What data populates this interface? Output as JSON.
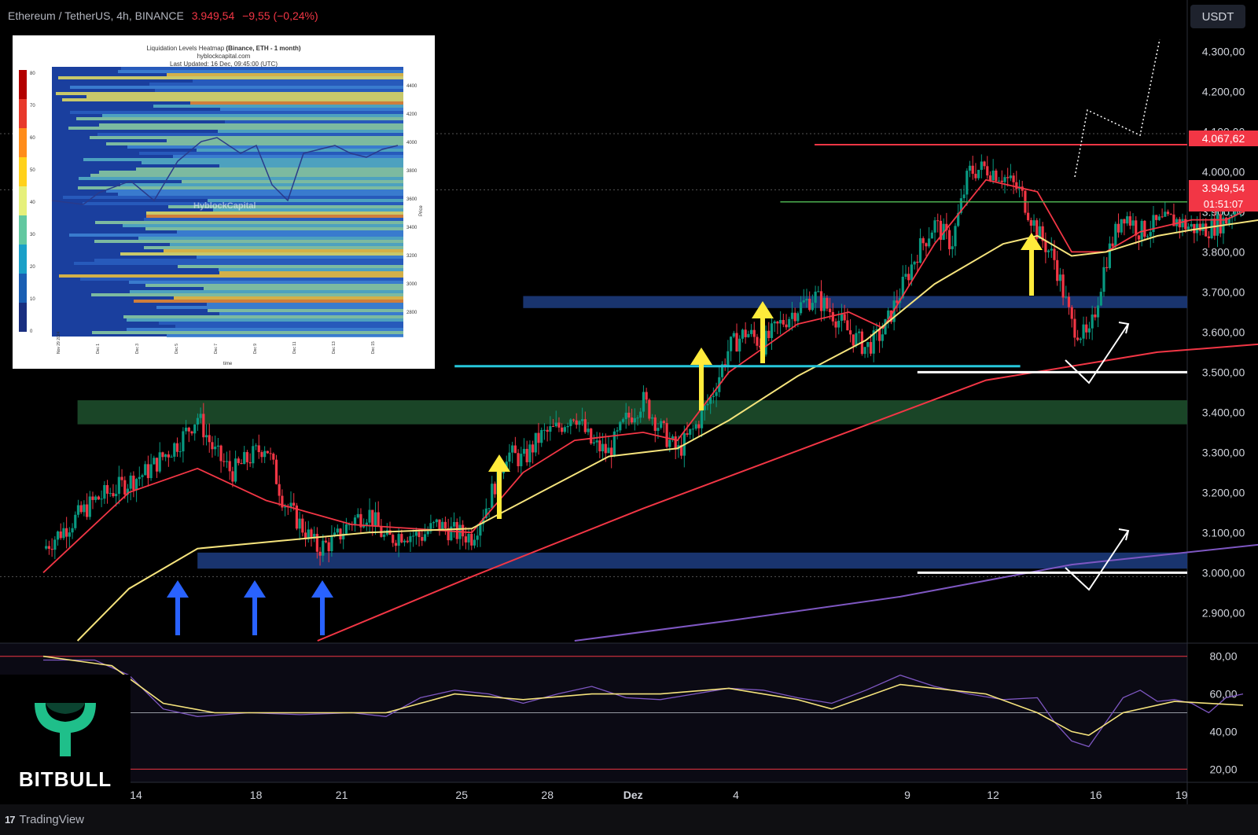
{
  "header": {
    "symbol": "Ethereum / TetherUS, 4h, BINANCE",
    "price": "3.949,54",
    "change": "−9,55 (−0,24%)"
  },
  "currency_button": "USDT",
  "price_tags": {
    "resistance": "4.067,62",
    "last": "3.949,54",
    "countdown": "01:51:07"
  },
  "footer": {
    "logo": "17",
    "brand": "TradingView"
  },
  "brand_logo": {
    "text": "BITBULL",
    "color": "#1fbf8a"
  },
  "colors": {
    "up": "#089981",
    "down": "#f23645",
    "ema_fast": "#f23645",
    "ema_mid": "#f5e37c",
    "ema_slow": "#f23645",
    "ema_long": "#7e57c2",
    "support_zone_blue": "#1c3a7a",
    "support_zone_green": "#1d4d2b",
    "cyan_line": "#26c6da",
    "arrow_blue": "#2962ff",
    "arrow_yellow": "#ffeb3b"
  },
  "inset": {
    "title": "Liquidation Levels Heatmap",
    "title_bold": "(Binance, ETH - 1 month)",
    "source": "hyblockcapital.com",
    "updated": "Last Updated: 16 Dec, 09:45:00 (UTC)",
    "watermark": "HyblockCapital",
    "y_ticks": [
      "4400",
      "4200",
      "4000",
      "3800",
      "3600",
      "3400",
      "3200",
      "3000",
      "2800"
    ],
    "x_ticks": [
      "Nov 29 2024",
      "Dec 1",
      "Dec 3",
      "Dec 5",
      "Dec 7",
      "Dec 9",
      "Dec 11",
      "Dec 13",
      "Dec 15"
    ],
    "x_label": "time",
    "y_label": "Price",
    "colorbar_ticks": [
      "80",
      "70",
      "60",
      "50",
      "40",
      "30",
      "20",
      "10",
      "0"
    ]
  },
  "chart_data": [
    {
      "type": "candlestick",
      "title": "Ethereum / TetherUS, 4h, BINANCE",
      "x_ticks": [
        "14",
        "18",
        "21",
        "25",
        "28",
        "Dez",
        "4",
        "9",
        "12",
        "16",
        "19"
      ],
      "y_ticks": [
        "4.300,00",
        "4.200,00",
        "4.100,00",
        "4.000,00",
        "3.900,00",
        "3.800,00",
        "3.700,00",
        "3.600,00",
        "3.500,00",
        "3.400,00",
        "3.300,00",
        "3.200,00",
        "3.100,00",
        "3.000,00",
        "2.900,00"
      ],
      "ylim": [
        2830,
        4350
      ],
      "close_path": [
        [
          0,
          3060
        ],
        [
          3,
          3180
        ],
        [
          6,
          3250
        ],
        [
          8,
          3330
        ],
        [
          9,
          3390
        ],
        [
          10,
          3300
        ],
        [
          11,
          3250
        ],
        [
          13,
          3320
        ],
        [
          14,
          3180
        ],
        [
          16,
          3060
        ],
        [
          17,
          3080
        ],
        [
          18,
          3130
        ],
        [
          19,
          3150
        ],
        [
          20,
          3080
        ],
        [
          21,
          3100
        ],
        [
          22,
          3090
        ],
        [
          23,
          3120
        ],
        [
          24,
          3100
        ],
        [
          25,
          3090
        ],
        [
          26,
          3180
        ],
        [
          27,
          3300
        ],
        [
          28,
          3280
        ],
        [
          29,
          3340
        ],
        [
          30,
          3360
        ],
        [
          31,
          3400
        ],
        [
          32,
          3320
        ],
        [
          33,
          3300
        ],
        [
          34,
          3380
        ],
        [
          35,
          3430
        ],
        [
          36,
          3360
        ],
        [
          37,
          3300
        ],
        [
          38,
          3360
        ],
        [
          39,
          3440
        ],
        [
          40,
          3560
        ],
        [
          41,
          3600
        ],
        [
          42,
          3570
        ],
        [
          43,
          3620
        ],
        [
          44,
          3660
        ],
        [
          45,
          3690
        ],
        [
          46,
          3650
        ],
        [
          47,
          3600
        ],
        [
          48,
          3560
        ],
        [
          49,
          3600
        ],
        [
          50,
          3700
        ],
        [
          51,
          3800
        ],
        [
          52,
          3870
        ],
        [
          53,
          3820
        ],
        [
          54,
          4000
        ],
        [
          55,
          4010
        ],
        [
          56,
          3990
        ],
        [
          57,
          3950
        ],
        [
          58,
          3850
        ],
        [
          59,
          3780
        ],
        [
          60,
          3620
        ],
        [
          61,
          3580
        ],
        [
          62,
          3780
        ],
        [
          63,
          3900
        ],
        [
          64,
          3850
        ],
        [
          65,
          3870
        ],
        [
          66,
          3880
        ],
        [
          67,
          3860
        ],
        [
          68,
          3860
        ],
        [
          69,
          3880
        ],
        [
          70,
          3940
        ],
        [
          70.5,
          3949.54
        ]
      ],
      "emas": [
        {
          "name": "EMA fast",
          "color": "#f23645",
          "points": [
            [
              0,
              3000
            ],
            [
              5,
              3200
            ],
            [
              9,
              3260
            ],
            [
              13,
              3180
            ],
            [
              18,
              3120
            ],
            [
              25,
              3100
            ],
            [
              28,
              3250
            ],
            [
              31,
              3330
            ],
            [
              35,
              3350
            ],
            [
              37,
              3330
            ],
            [
              40,
              3500
            ],
            [
              44,
              3620
            ],
            [
              47,
              3650
            ],
            [
              49,
              3610
            ],
            [
              52,
              3820
            ],
            [
              55,
              3980
            ],
            [
              58,
              3950
            ],
            [
              60,
              3800
            ],
            [
              62,
              3800
            ],
            [
              64,
              3850
            ],
            [
              67,
              3880
            ],
            [
              69,
              3880
            ],
            [
              71,
              3920
            ]
          ]
        },
        {
          "name": "EMA mid",
          "color": "#f5e37c",
          "points": [
            [
              2,
              2830
            ],
            [
              5,
              2960
            ],
            [
              9,
              3060
            ],
            [
              14,
              3080
            ],
            [
              19,
              3100
            ],
            [
              25,
              3110
            ],
            [
              29,
              3200
            ],
            [
              33,
              3290
            ],
            [
              37,
              3310
            ],
            [
              40,
              3380
            ],
            [
              44,
              3490
            ],
            [
              48,
              3580
            ],
            [
              52,
              3720
            ],
            [
              56,
              3820
            ],
            [
              58,
              3840
            ],
            [
              60,
              3790
            ],
            [
              62,
              3800
            ],
            [
              65,
              3840
            ],
            [
              67,
              3855
            ],
            [
              71,
              3880
            ]
          ]
        },
        {
          "name": "EMA slow",
          "color": "#f23645",
          "points": [
            [
              16,
              2830
            ],
            [
              25,
              2990
            ],
            [
              35,
              3160
            ],
            [
              45,
              3320
            ],
            [
              55,
              3480
            ],
            [
              65,
              3550
            ],
            [
              71,
              3570
            ]
          ]
        },
        {
          "name": "EMA long",
          "color": "#7e57c2",
          "points": [
            [
              31,
              2830
            ],
            [
              40,
              2880
            ],
            [
              50,
              2940
            ],
            [
              60,
              3020
            ],
            [
              71,
              3070
            ]
          ]
        }
      ],
      "levels": {
        "resistance": 4067.62,
        "green_line": 3925,
        "cyan_support": 3515,
        "white_support_1": 3500,
        "white_support_2": 3000,
        "blue_zone_top": [
          3660,
          3690
        ],
        "green_zone": [
          3370,
          3430
        ],
        "blue_zone_bottom": [
          3010,
          3050
        ]
      }
    },
    {
      "type": "line",
      "title": "RSI",
      "y_ticks": [
        "80,00",
        "60,00",
        "40,00",
        "20,00"
      ],
      "ylim": [
        13,
        87
      ],
      "levels": [
        80,
        50,
        20
      ],
      "series": [
        {
          "name": "",
          "color": "#7e57c2",
          "points": [
            [
              0,
              78
            ],
            [
              3,
              78
            ],
            [
              5,
              70
            ],
            [
              7,
              52
            ],
            [
              9,
              48
            ],
            [
              12,
              50
            ],
            [
              15,
              49
            ],
            [
              18,
              50
            ],
            [
              20,
              48
            ],
            [
              22,
              58
            ],
            [
              24,
              62
            ],
            [
              26,
              60
            ],
            [
              28,
              55
            ],
            [
              30,
              60
            ],
            [
              32,
              64
            ],
            [
              34,
              58
            ],
            [
              36,
              57
            ],
            [
              38,
              60
            ],
            [
              40,
              63
            ],
            [
              42,
              62
            ],
            [
              44,
              58
            ],
            [
              46,
              55
            ],
            [
              48,
              62
            ],
            [
              50,
              70
            ],
            [
              52,
              64
            ],
            [
              54,
              60
            ],
            [
              56,
              57
            ],
            [
              58,
              58
            ],
            [
              59,
              45
            ],
            [
              60,
              35
            ],
            [
              61,
              32
            ],
            [
              62,
              45
            ],
            [
              63,
              58
            ],
            [
              64,
              62
            ],
            [
              65,
              56
            ],
            [
              66,
              57
            ],
            [
              67,
              55
            ],
            [
              68,
              50
            ],
            [
              69,
              58
            ],
            [
              70,
              60
            ]
          ]
        },
        {
          "name": "",
          "color": "#f5e37c",
          "points": [
            [
              0,
              80
            ],
            [
              4,
              75
            ],
            [
              7,
              55
            ],
            [
              10,
              50
            ],
            [
              15,
              50
            ],
            [
              20,
              50
            ],
            [
              24,
              60
            ],
            [
              28,
              57
            ],
            [
              32,
              60
            ],
            [
              36,
              60
            ],
            [
              40,
              63
            ],
            [
              44,
              57
            ],
            [
              46,
              52
            ],
            [
              50,
              65
            ],
            [
              55,
              60
            ],
            [
              58,
              50
            ],
            [
              60,
              40
            ],
            [
              61,
              38
            ],
            [
              63,
              50
            ],
            [
              66,
              56
            ],
            [
              70,
              54
            ]
          ]
        }
      ]
    }
  ]
}
